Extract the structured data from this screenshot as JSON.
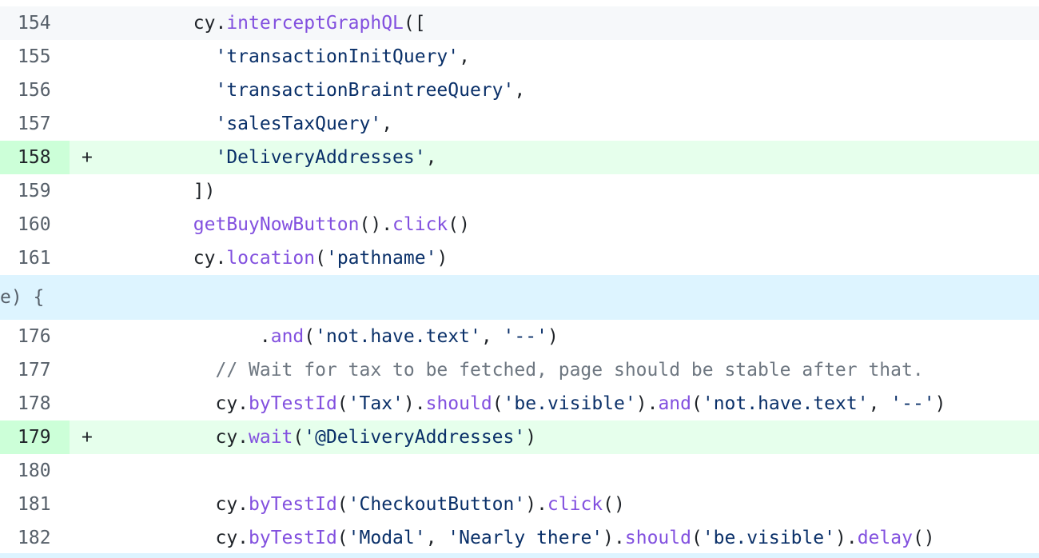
{
  "diff": {
    "lines": [
      {
        "num": "154",
        "marker": "",
        "type": "context",
        "tokens": [
          {
            "t": "        cy.",
            "c": "id"
          },
          {
            "t": "interceptGraphQL",
            "c": "fn"
          },
          {
            "t": "([",
            "c": "id"
          }
        ]
      },
      {
        "num": "155",
        "marker": "",
        "type": "context",
        "tokens": [
          {
            "t": "          'transactionInitQuery'",
            "c": "str"
          },
          {
            "t": ",",
            "c": "id"
          }
        ]
      },
      {
        "num": "156",
        "marker": "",
        "type": "context",
        "tokens": [
          {
            "t": "          'transactionBraintreeQuery'",
            "c": "str"
          },
          {
            "t": ",",
            "c": "id"
          }
        ]
      },
      {
        "num": "157",
        "marker": "",
        "type": "context",
        "tokens": [
          {
            "t": "          'salesTaxQuery'",
            "c": "str"
          },
          {
            "t": ",",
            "c": "id"
          }
        ]
      },
      {
        "num": "158",
        "marker": "+",
        "type": "added",
        "tokens": [
          {
            "t": "          'DeliveryAddresses'",
            "c": "str"
          },
          {
            "t": ",",
            "c": "id"
          }
        ]
      },
      {
        "num": "159",
        "marker": "",
        "type": "context",
        "tokens": [
          {
            "t": "        ])",
            "c": "id"
          }
        ]
      },
      {
        "num": "160",
        "marker": "",
        "type": "context",
        "tokens": [
          {
            "t": "        ",
            "c": "id"
          },
          {
            "t": "getBuyNowButton",
            "c": "fn"
          },
          {
            "t": "().",
            "c": "id"
          },
          {
            "t": "click",
            "c": "fn"
          },
          {
            "t": "()",
            "c": "id"
          }
        ]
      },
      {
        "num": "161",
        "marker": "",
        "type": "context",
        "tokens": [
          {
            "t": "        cy.",
            "c": "id"
          },
          {
            "t": "location",
            "c": "fn"
          },
          {
            "t": "(",
            "c": "id"
          },
          {
            "t": "'pathname'",
            "c": "str"
          },
          {
            "t": ")",
            "c": "id"
          }
        ]
      }
    ],
    "hunk_header": "e) {",
    "lines2": [
      {
        "num": "176",
        "marker": "",
        "type": "context",
        "tokens": [
          {
            "t": "              .",
            "c": "id"
          },
          {
            "t": "and",
            "c": "fn"
          },
          {
            "t": "(",
            "c": "id"
          },
          {
            "t": "'not.have.text'",
            "c": "str"
          },
          {
            "t": ", ",
            "c": "id"
          },
          {
            "t": "'--'",
            "c": "str"
          },
          {
            "t": ")",
            "c": "id"
          }
        ]
      },
      {
        "num": "177",
        "marker": "",
        "type": "context",
        "tokens": [
          {
            "t": "          // Wait for tax to be fetched, page should be stable after that.",
            "c": "cm"
          }
        ]
      },
      {
        "num": "178",
        "marker": "",
        "type": "context",
        "tokens": [
          {
            "t": "          cy.",
            "c": "id"
          },
          {
            "t": "byTestId",
            "c": "fn"
          },
          {
            "t": "(",
            "c": "id"
          },
          {
            "t": "'Tax'",
            "c": "str"
          },
          {
            "t": ").",
            "c": "id"
          },
          {
            "t": "should",
            "c": "fn"
          },
          {
            "t": "(",
            "c": "id"
          },
          {
            "t": "'be.visible'",
            "c": "str"
          },
          {
            "t": ").",
            "c": "id"
          },
          {
            "t": "and",
            "c": "fn"
          },
          {
            "t": "(",
            "c": "id"
          },
          {
            "t": "'not.have.text'",
            "c": "str"
          },
          {
            "t": ", ",
            "c": "id"
          },
          {
            "t": "'--'",
            "c": "str"
          },
          {
            "t": ")",
            "c": "id"
          }
        ]
      },
      {
        "num": "179",
        "marker": "+",
        "type": "added",
        "tokens": [
          {
            "t": "          cy.",
            "c": "id"
          },
          {
            "t": "wait",
            "c": "fn"
          },
          {
            "t": "(",
            "c": "id"
          },
          {
            "t": "'@DeliveryAddresses'",
            "c": "str"
          },
          {
            "t": ")",
            "c": "id"
          }
        ]
      },
      {
        "num": "180",
        "marker": "",
        "type": "context",
        "tokens": []
      },
      {
        "num": "181",
        "marker": "",
        "type": "context",
        "tokens": [
          {
            "t": "          cy.",
            "c": "id"
          },
          {
            "t": "byTestId",
            "c": "fn"
          },
          {
            "t": "(",
            "c": "id"
          },
          {
            "t": "'CheckoutButton'",
            "c": "str"
          },
          {
            "t": ").",
            "c": "id"
          },
          {
            "t": "click",
            "c": "fn"
          },
          {
            "t": "()",
            "c": "id"
          }
        ]
      },
      {
        "num": "182",
        "marker": "",
        "type": "context",
        "tokens": [
          {
            "t": "          cy.",
            "c": "id"
          },
          {
            "t": "byTestId",
            "c": "fn"
          },
          {
            "t": "(",
            "c": "id"
          },
          {
            "t": "'Modal'",
            "c": "str"
          },
          {
            "t": ", ",
            "c": "id"
          },
          {
            "t": "'Nearly there'",
            "c": "str"
          },
          {
            "t": ").",
            "c": "id"
          },
          {
            "t": "should",
            "c": "fn"
          },
          {
            "t": "(",
            "c": "id"
          },
          {
            "t": "'be.visible'",
            "c": "str"
          },
          {
            "t": ").",
            "c": "id"
          },
          {
            "t": "delay",
            "c": "fn"
          },
          {
            "t": "()",
            "c": "id"
          }
        ]
      }
    ]
  },
  "colors": {
    "added_bg": "#e6ffec",
    "added_gutter_bg": "#ccffd8",
    "hunk_bg": "#ddf4ff",
    "function": "#8250df",
    "string": "#0a3069",
    "comment": "#6e7781"
  }
}
